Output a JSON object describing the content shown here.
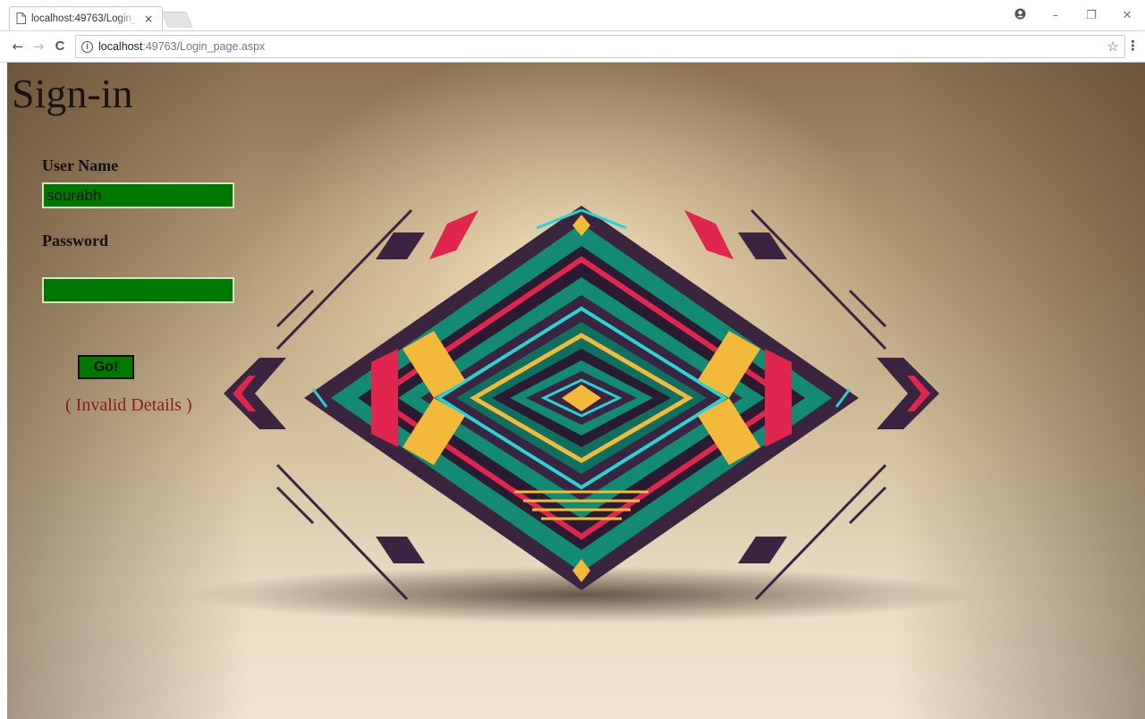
{
  "browser": {
    "tab_title": "localhost:49763/Login_page.aspx",
    "tab_close": "×",
    "url_host": "localhost",
    "url_path": ":49763/Login_page.aspx",
    "back": "←",
    "forward": "→",
    "reload": "C",
    "info": "i",
    "bookmark": "☆",
    "menu": "⋮",
    "window_controls": {
      "account": "👤",
      "minimize": "–",
      "restore": "❐",
      "close": "✕"
    }
  },
  "page": {
    "heading": "Sign-in",
    "username_label": "User Name",
    "username_value": "sourabh",
    "password_label": "Password",
    "password_value": "",
    "submit_label": "Go!",
    "error_text": "( Invalid Details )"
  },
  "colors": {
    "field_bg": "#007800",
    "error": "#8b1a1a",
    "art_teal": "#138a74",
    "art_purple": "#3a2440",
    "art_red": "#e0264e",
    "art_cyan": "#27d3d3",
    "art_yellow": "#f2b93a"
  }
}
